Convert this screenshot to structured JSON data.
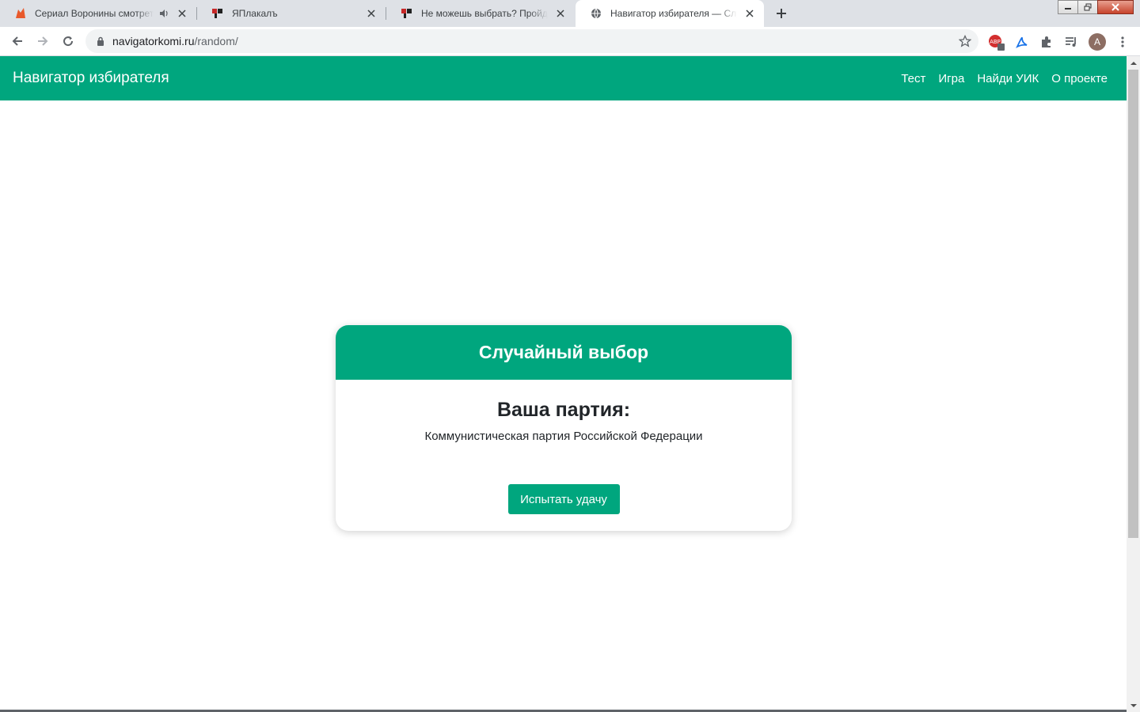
{
  "browser": {
    "tabs": [
      {
        "title": "Сериал Воронины смотреть онлайн",
        "favicon": "fox-icon",
        "audio": true,
        "active": false
      },
      {
        "title": "ЯПлакалъ",
        "favicon": "yaplakal-icon",
        "audio": false,
        "active": false
      },
      {
        "title": "Не можешь выбрать? Пройди тест",
        "favicon": "yaplakal-icon",
        "audio": false,
        "active": false
      },
      {
        "title": "Навигатор избирателя — Случайный выбор",
        "favicon": "globe-icon",
        "audio": false,
        "active": true
      }
    ],
    "url_host": "navigatorkomi.ru",
    "url_path": "/random/",
    "profile_initial": "A",
    "extension_badge": "1"
  },
  "site": {
    "brand": "Навигатор избирателя",
    "nav": [
      "Тест",
      "Игра",
      "Найди УИК",
      "О проекте"
    ],
    "accent_color": "#00a67e"
  },
  "card": {
    "header": "Случайный выбор",
    "subtitle": "Ваша партия:",
    "party": "Коммунистическая партия Российской Федерации",
    "button_label": "Испытать удачу"
  }
}
